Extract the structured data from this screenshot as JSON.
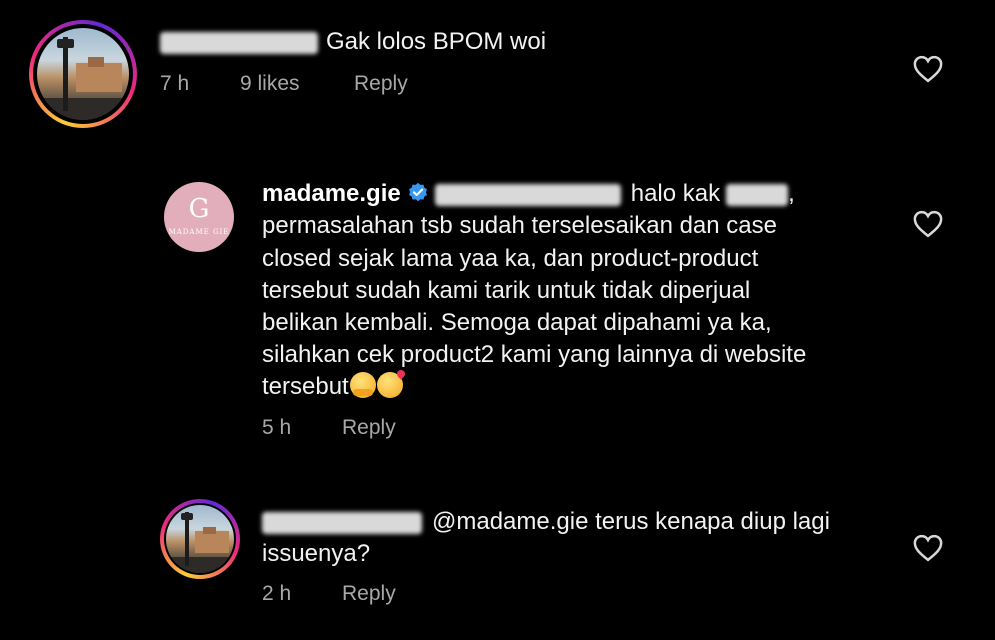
{
  "comments": [
    {
      "text": "Gak lolos BPOM woi",
      "time": "7 h",
      "likes": "9 likes",
      "reply_label": "Reply"
    },
    {
      "username": "madame.gie",
      "brand_initial": "G",
      "brand_name": "MADAME GIE",
      "lines": [
        "halo kak",
        "permasalahan tsb sudah terselesaikan dan case",
        "closed sejak lama yaa ka, dan product-product",
        "tersebut sudah kami tarik untuk tidak diperjual",
        "belikan kembali.  Semoga dapat dipahami ya ka,",
        "silahkan cek product2 kami yang lainnya di website",
        "tersebut"
      ],
      "time": "5 h",
      "reply_label": "Reply"
    },
    {
      "mention": "@madame.gie",
      "lines": [
        "terus kenapa diup lagi",
        "issuenya?"
      ],
      "time": "2 h",
      "reply_label": "Reply"
    }
  ],
  "icons": {
    "heart": "heart-outline-icon",
    "verified": "verified-badge-icon"
  },
  "colors": {
    "background": "#000000",
    "text": "#f2f2f2",
    "meta": "#a8a8a8",
    "verified": "#3897f0",
    "brand_avatar": "#e3aebb"
  }
}
